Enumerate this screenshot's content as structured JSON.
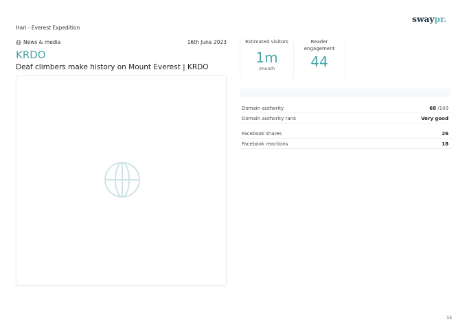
{
  "logo": {
    "part1": "sway",
    "part2": "pr."
  },
  "report_title": "Hari - Everest Expedition",
  "article": {
    "category": "News & media",
    "date": "16th June 2023",
    "outlet": "KRDO",
    "headline": "Deaf climbers make history on Mount Everest | KRDO",
    "placeholder_icon": "globe-icon"
  },
  "stats": {
    "visitors": {
      "label": "Estimated visitors",
      "value": "1m",
      "unit": "/month"
    },
    "engagement": {
      "label": "Reader engagement",
      "value": "44"
    }
  },
  "metrics": [
    {
      "label": "Domain authority",
      "value": "68",
      "suffix": " /100"
    },
    {
      "label": "Domain authority rank",
      "value": "Very good",
      "suffix": ""
    },
    {
      "label": "Facebook shares",
      "value": "26",
      "suffix": ""
    },
    {
      "label": "Facebook reactions",
      "value": "18",
      "suffix": ""
    }
  ],
  "colors": {
    "accent": "#4aa3a8",
    "logo_dark": "#2a3a4a",
    "logo_light": "#6bb5b8",
    "icon": "#cfe3e5"
  },
  "page_number": "15"
}
